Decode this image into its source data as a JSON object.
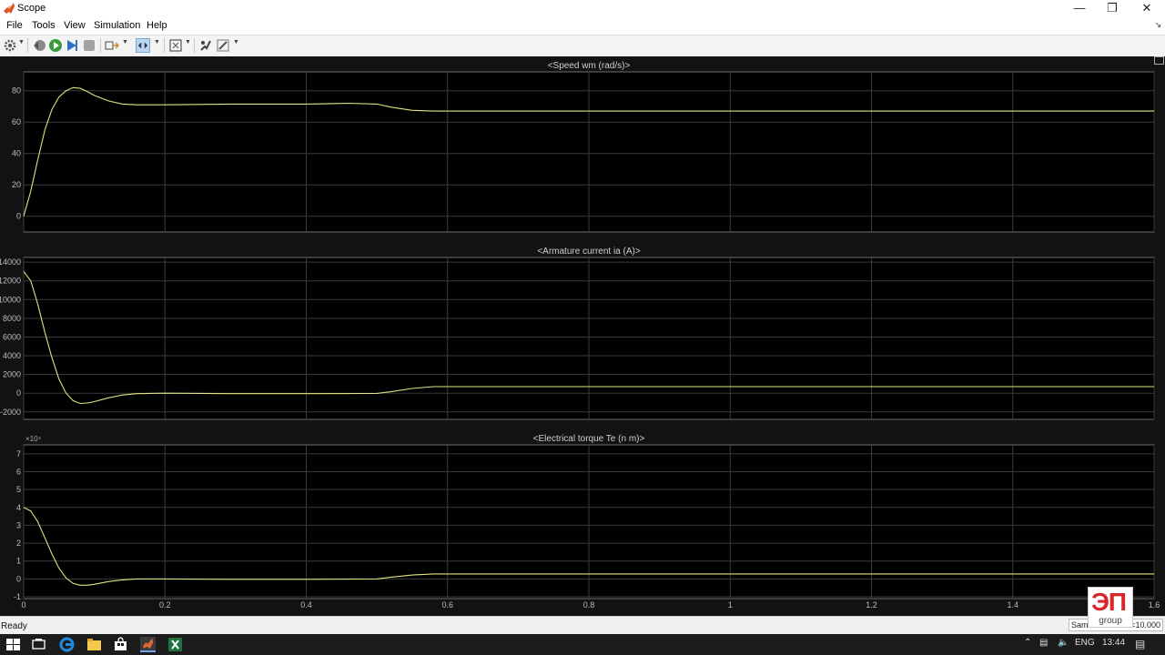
{
  "window": {
    "title": "Scope"
  },
  "menubar": {
    "items": [
      "File",
      "Tools",
      "View",
      "Simulation",
      "Help"
    ]
  },
  "toolbar": {
    "icons": [
      "gear-icon",
      "step-back-icon",
      "run-icon",
      "step-forward-icon",
      "stop-icon",
      "signal-highlight-icon",
      "zoom-icon",
      "autoscale-icon",
      "style-icon",
      "edit-icon"
    ]
  },
  "plots": [
    {
      "title": "<Speed wm (rad/s)>",
      "multiplier": ""
    },
    {
      "title": "<Armature current ia (A)>",
      "multiplier": ""
    },
    {
      "title": "<Electrical torque Te (n m)>",
      "multiplier": "×10⁴"
    }
  ],
  "chart_data": [
    {
      "type": "line",
      "title": "<Speed wm (rad/s)>",
      "xlim": [
        0,
        1.6
      ],
      "ylim": [
        -10,
        92
      ],
      "yticks": [
        0,
        20,
        40,
        60,
        80
      ],
      "grid": true,
      "series": [
        {
          "color": "#e2e281",
          "x": [
            0,
            0.01,
            0.02,
            0.03,
            0.04,
            0.05,
            0.06,
            0.07,
            0.08,
            0.09,
            0.1,
            0.12,
            0.14,
            0.16,
            0.2,
            0.3,
            0.4,
            0.46,
            0.5,
            0.52,
            0.55,
            0.58,
            0.62,
            0.8,
            1.2,
            1.63
          ],
          "y": [
            0,
            16,
            36,
            55,
            68,
            76,
            80,
            82,
            81.5,
            79.5,
            77,
            73.5,
            71.5,
            71,
            71,
            71.5,
            71.5,
            72,
            71.5,
            69.5,
            67.5,
            67,
            67,
            67,
            67,
            67
          ]
        }
      ]
    },
    {
      "type": "line",
      "title": "<Armature current ia (A)>",
      "xlim": [
        0,
        1.6
      ],
      "ylim": [
        -2800,
        14500
      ],
      "yticks": [
        -2000,
        0,
        2000,
        4000,
        6000,
        8000,
        10000,
        12000,
        14000
      ],
      "grid": true,
      "series": [
        {
          "color": "#e2e281",
          "x": [
            0,
            0.01,
            0.02,
            0.03,
            0.04,
            0.05,
            0.06,
            0.07,
            0.08,
            0.09,
            0.1,
            0.12,
            0.14,
            0.16,
            0.2,
            0.3,
            0.4,
            0.5,
            0.52,
            0.55,
            0.58,
            0.62,
            0.8,
            1.2,
            1.63
          ],
          "y": [
            13000,
            12000,
            9500,
            6500,
            3800,
            1500,
            0,
            -800,
            -1100,
            -1050,
            -900,
            -500,
            -200,
            -50,
            0,
            -50,
            -50,
            -20,
            150,
            500,
            700,
            700,
            700,
            700,
            700
          ]
        }
      ]
    },
    {
      "type": "line",
      "title": "<Electrical torque Te (n m)>",
      "xlim": [
        0,
        1.6
      ],
      "ylim": [
        -1.1,
        7.5
      ],
      "yticks": [
        -1,
        0,
        1,
        2,
        3,
        4,
        5,
        6,
        7
      ],
      "multiplier": "×10⁴",
      "grid": true,
      "series": [
        {
          "color": "#e2e281",
          "x": [
            0,
            0.01,
            0.02,
            0.03,
            0.04,
            0.05,
            0.06,
            0.07,
            0.08,
            0.09,
            0.1,
            0.12,
            0.14,
            0.16,
            0.2,
            0.3,
            0.4,
            0.5,
            0.52,
            0.55,
            0.58,
            0.62,
            0.8,
            1.2,
            1.63
          ],
          "y": [
            4.0,
            3.8,
            3.2,
            2.3,
            1.4,
            0.6,
            0.05,
            -0.25,
            -0.35,
            -0.35,
            -0.3,
            -0.15,
            -0.05,
            0.0,
            0.0,
            -0.02,
            -0.02,
            0.0,
            0.1,
            0.22,
            0.28,
            0.28,
            0.28,
            0.28,
            0.28
          ]
        }
      ]
    }
  ],
  "x_axis": {
    "ticks": [
      "0",
      "0.2",
      "0.4",
      "0.6",
      "0.8",
      "1",
      "1.2",
      "1.4",
      "1.6"
    ]
  },
  "status": {
    "text": "Ready",
    "right_label": "Sam",
    "right_value": "=10.000"
  },
  "watermark": {
    "mark": "ЭП",
    "text": "group"
  },
  "taskbar": {
    "icons": [
      "windows-start-icon",
      "task-view-icon",
      "edge-icon",
      "file-explorer-icon",
      "store-icon",
      "matlab-icon",
      "excel-icon"
    ],
    "language": "ENG",
    "time": "13:44"
  }
}
